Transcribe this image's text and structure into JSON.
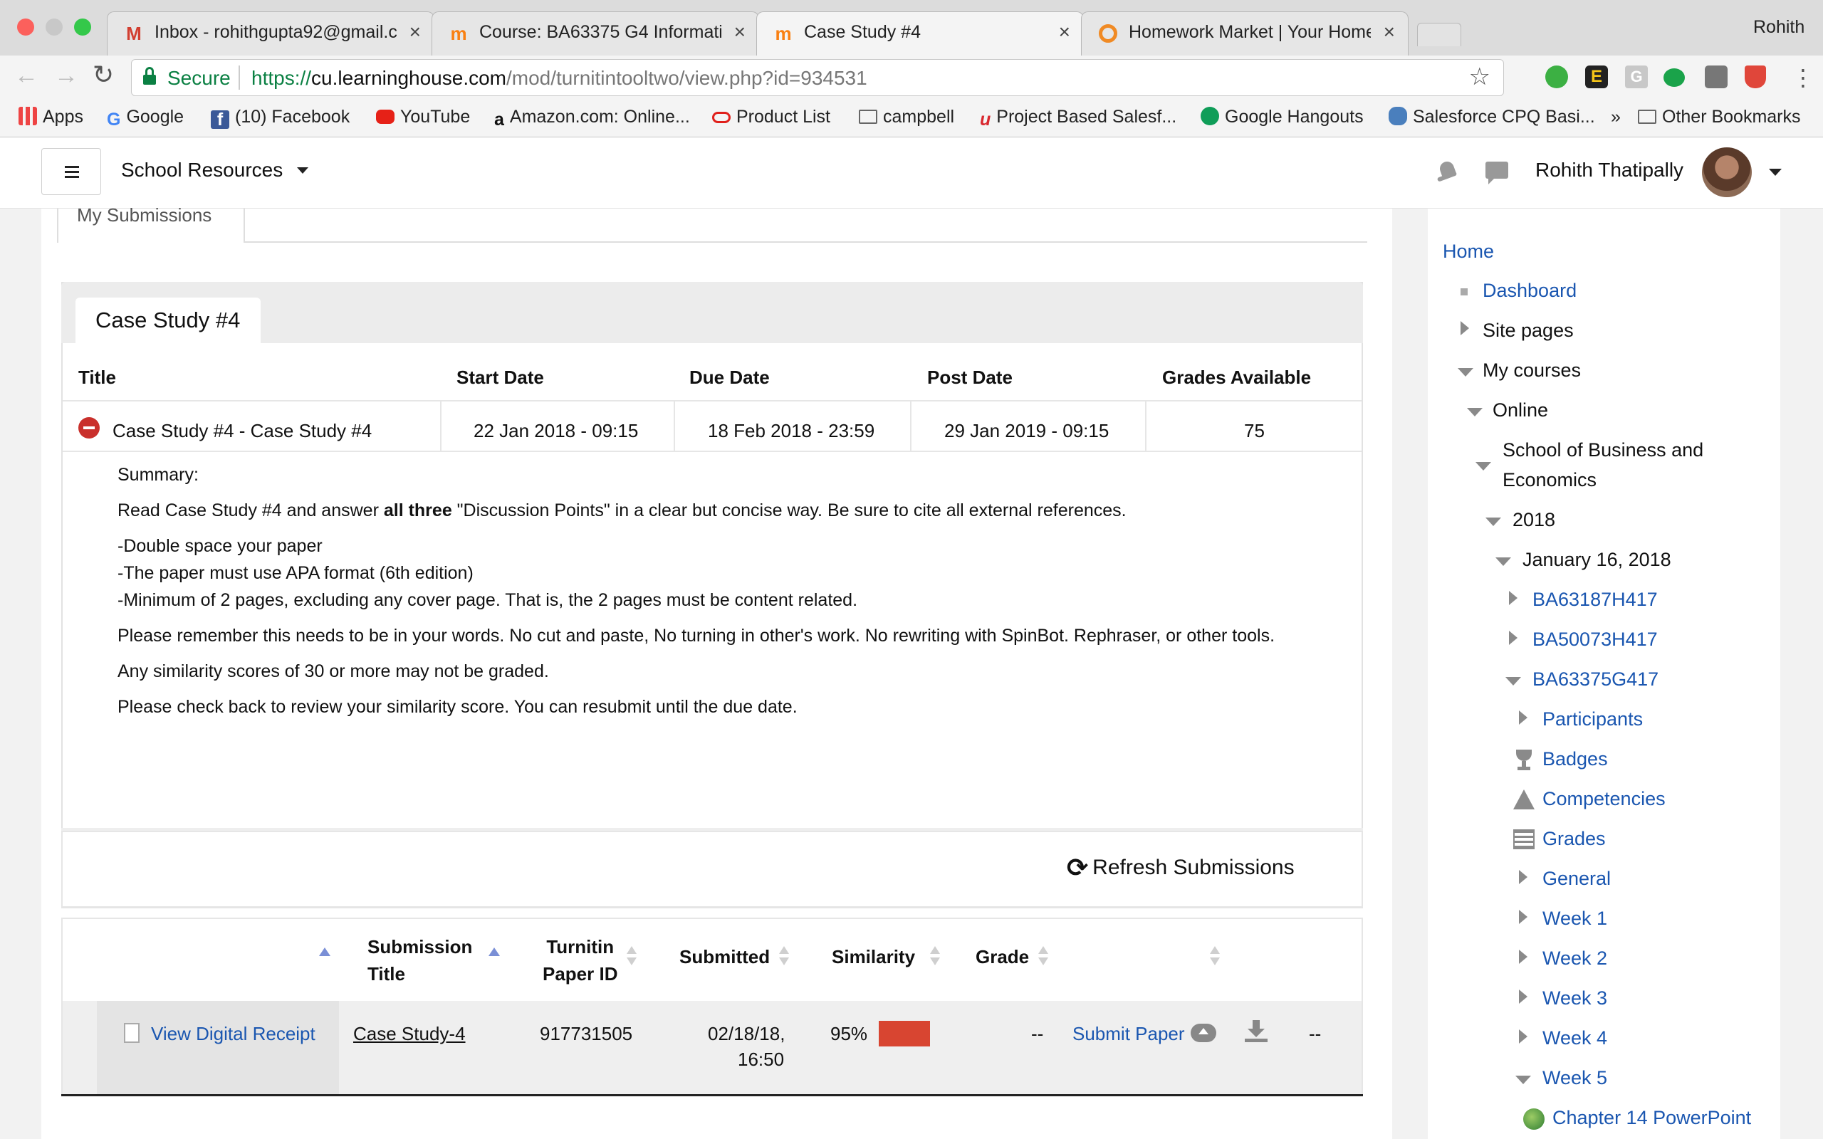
{
  "browser": {
    "profile_name": "Rohith",
    "tabs": [
      {
        "title": "Inbox - rohithgupta92@gmail.c",
        "icon": "gmail-icon"
      },
      {
        "title": "Course: BA63375 G4 Informati",
        "icon": "moodle-icon"
      },
      {
        "title": "Case Study #4",
        "icon": "moodle-icon"
      },
      {
        "title": "Homework Market | Your Home",
        "icon": "homework-market-icon"
      }
    ],
    "url": {
      "secure_label": "Secure",
      "scheme": "https://",
      "host": "cu.learninghouse.com",
      "path": "/mod/turnitintooltwo/view.php?id=934531"
    },
    "bookmarks": [
      "Apps",
      "Google",
      "(10) Facebook",
      "YouTube",
      "Amazon.com: Online...",
      "Product List",
      "campbell",
      "Project Based Salesf...",
      "Google Hangouts",
      "Salesforce CPQ Basi..."
    ],
    "bookmarks_overflow": "»",
    "other_bookmarks": "Other Bookmarks"
  },
  "header": {
    "menu_label": "School Resources",
    "user_name": "Rohith Thatipally"
  },
  "page": {
    "my_submissions_tab": "My Submissions",
    "assignment_tab": "Case Study #4",
    "table": {
      "headers": [
        "Title",
        "Start Date",
        "Due Date",
        "Post Date",
        "Grades Available"
      ],
      "row": {
        "title": "Case Study #4 - Case Study #4",
        "start_date": "22 Jan 2018 - 09:15",
        "due_date": "18 Feb 2018 - 23:59",
        "post_date": "29 Jan 2019 - 09:15",
        "grades_available": "75"
      }
    },
    "summary": {
      "label": "Summary:",
      "line1_pre": "Read Case Study #4  and answer ",
      "line1_bold": "all three",
      "line1_post": " \"Discussion Points\" in a clear but concise way. Be sure to cite all external references.",
      "bullet1": "-Double space your paper",
      "bullet2": "-The paper must use APA format (6th edition)",
      "bullet3": "-Minimum of 2 pages, excluding any cover page. That is, the 2 pages must be content related.",
      "line2": "Please remember this needs to be in your words.  No cut and paste, No turning in other's work.  No rewriting with SpinBot. Rephraser, or other tools.",
      "line3": "Any similarity scores of 30 or more may not be graded.",
      "line4": "Please check back to review your similarity score.  You can resubmit until the due date."
    },
    "refresh_label": "Refresh Submissions",
    "submissions": {
      "headers": {
        "submission_title_1": "Submission",
        "submission_title_2": "Title",
        "paper_id_1": "Turnitin",
        "paper_id_2": "Paper ID",
        "submitted": "Submitted",
        "similarity": "Similarity",
        "grade": "Grade"
      },
      "row": {
        "receipt_label": "View Digital Receipt",
        "title": "Case Study-4",
        "paper_id": "917731505",
        "submitted_1": "02/18/18,",
        "submitted_2": "16:50",
        "similarity": "95%",
        "similarity_percent": 95,
        "similarity_color": "#d84531",
        "grade": "--",
        "submit_label": "Submit Paper",
        "extra": "--"
      }
    }
  },
  "sidebar": {
    "items": [
      {
        "label": "Home"
      },
      {
        "label": "Dashboard"
      },
      {
        "label": "Site pages"
      },
      {
        "label": "My courses"
      },
      {
        "label": "Online"
      },
      {
        "label": "School of Business and"
      },
      {
        "label": "Economics"
      },
      {
        "label": "2018"
      },
      {
        "label": "January 16, 2018"
      },
      {
        "label": "BA63187H417"
      },
      {
        "label": "BA50073H417"
      },
      {
        "label": "BA63375G417"
      },
      {
        "label": "Participants"
      },
      {
        "label": "Badges"
      },
      {
        "label": "Competencies"
      },
      {
        "label": "Grades"
      },
      {
        "label": "General"
      },
      {
        "label": "Week 1"
      },
      {
        "label": "Week 2"
      },
      {
        "label": "Week 3"
      },
      {
        "label": "Week 4"
      },
      {
        "label": "Week 5"
      },
      {
        "label": "Chapter 14 PowerPoint"
      }
    ]
  },
  "colors": {
    "link": "#1a56b0",
    "error_red": "#c9302c"
  }
}
